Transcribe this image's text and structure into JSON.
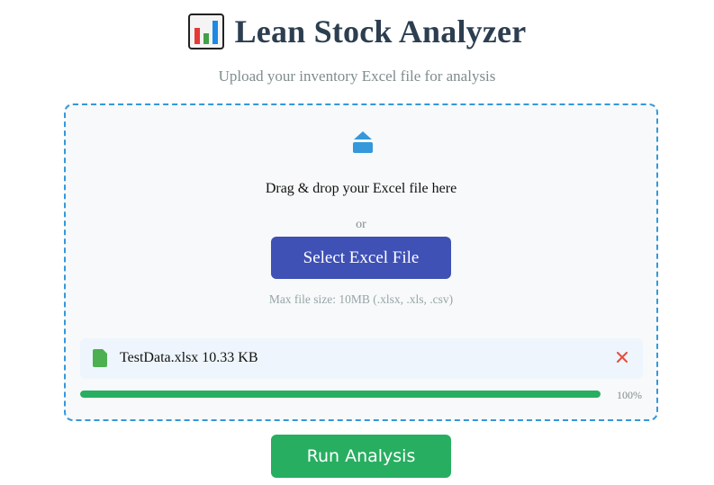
{
  "header": {
    "icon": "bar-chart-icon",
    "title": "Lean Stock Analyzer",
    "subtitle": "Upload your inventory Excel file for analysis"
  },
  "dropzone": {
    "icon": "upload-icon",
    "drag_text": "Drag & drop your Excel file here",
    "or_text": "or",
    "select_button_label": "Select Excel File",
    "max_text": "Max file size: 10MB (.xlsx, .xls, .csv)"
  },
  "file": {
    "icon": "file-icon",
    "name_and_size": "TestData.xlsx 10.33 KB",
    "remove_icon": "close-icon",
    "progress_percent": 100,
    "progress_text": "100%"
  },
  "actions": {
    "run_button_label": "Run Analysis"
  },
  "colors": {
    "accent_blue": "#3498db",
    "select_button": "#3f51b5",
    "success_green": "#27ae60",
    "remove_red": "#e74c3c",
    "title": "#2c3e50"
  }
}
